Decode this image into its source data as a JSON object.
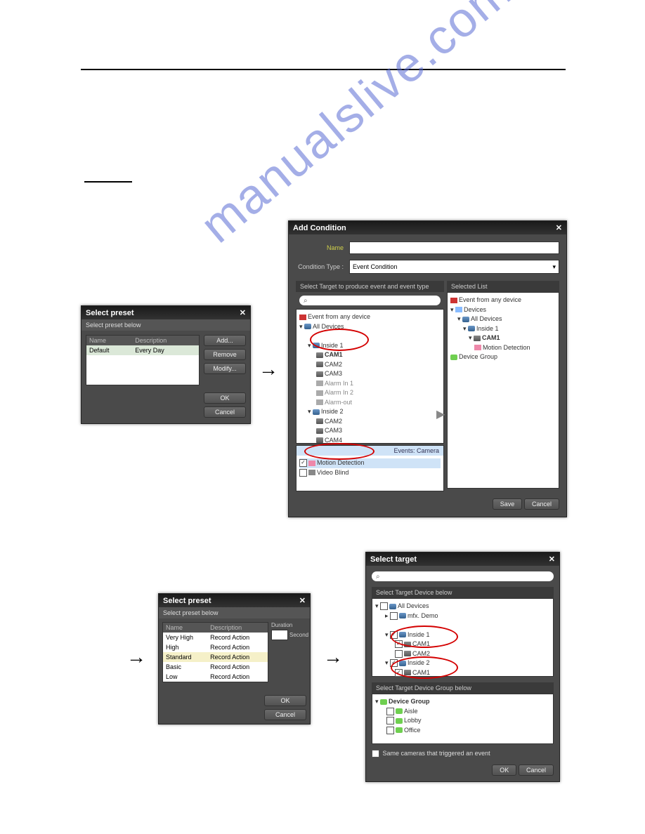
{
  "watermark": "manualslive.com",
  "dialog1": {
    "title": "Select preset",
    "subtitle": "Select preset below",
    "cols": {
      "name": "Name",
      "desc": "Description"
    },
    "rows": [
      {
        "name": "Default",
        "desc": "Every Day"
      }
    ],
    "buttons": {
      "add": "Add...",
      "remove": "Remove",
      "modify": "Modify...",
      "ok": "OK",
      "cancel": "Cancel"
    }
  },
  "dialog2": {
    "title": "Add Condition",
    "fields": {
      "name_label": "Name",
      "type_label": "Condition Type :",
      "type_value": "Event Condition"
    },
    "left_header": "Select Target to produce event and event type",
    "right_header": "Selected List",
    "search_placeholder": "",
    "tree": {
      "any": "Event from any device",
      "all": "All Devices",
      "inside1": "Inside 1",
      "cam1": "CAM1",
      "cam2": "CAM2",
      "cam3": "CAM3",
      "ain1": "Alarm In 1",
      "ain2": "Alarm In 2",
      "aout": "Alarm-out",
      "inside2": "Inside 2",
      "cam4": "CAM4",
      "event_section": "Events: Camera",
      "motion": "Motion Detection",
      "blind": "Video Blind"
    },
    "selected": {
      "any": "Event from any device",
      "devices": "Devices",
      "all": "All Devices",
      "inside1": "Inside 1",
      "cam1": "CAM1",
      "motion": "Motion Detection",
      "group": "Device Group"
    },
    "buttons": {
      "save": "Save",
      "cancel": "Cancel"
    }
  },
  "dialog3": {
    "title": "Select preset",
    "subtitle": "Select preset below",
    "cols": {
      "name": "Name",
      "desc": "Description",
      "dur": "Duration"
    },
    "rows": [
      {
        "name": "Very High",
        "desc": "Record Action"
      },
      {
        "name": "High",
        "desc": "Record Action"
      },
      {
        "name": "Standard",
        "desc": "Record Action"
      },
      {
        "name": "Basic",
        "desc": "Record Action"
      },
      {
        "name": "Low",
        "desc": "Record Action"
      }
    ],
    "dur_value": "Second",
    "buttons": {
      "ok": "OK",
      "cancel": "Cancel"
    }
  },
  "dialog4": {
    "title": "Select target",
    "search_placeholder": "",
    "header1": "Select Target Device below",
    "header2": "Select Target Device Group below",
    "tree": {
      "all": "All Devices",
      "ms": "mfx. Demo",
      "inside1": "Inside 1",
      "cam1": "CAM1",
      "cam2": "CAM2",
      "inside2": "Inside 2"
    },
    "groups": {
      "root": "Device Group",
      "g1": "Aisle",
      "g2": "Lobby",
      "g3": "Office"
    },
    "same_camera": "Same cameras that triggered an event",
    "buttons": {
      "ok": "OK",
      "cancel": "Cancel"
    }
  }
}
